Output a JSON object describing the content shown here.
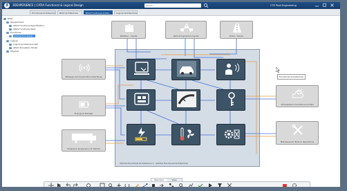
{
  "title_bar": {
    "app_title": "3DEXPERIENCE | CATIA Functional & Logical Design",
    "search_placeholder": "Search",
    "user_name": "CTE Prod Engineering"
  },
  "tabs": [
    {
      "label": "Functional Architecture"
    },
    {
      "label": "RFLP Architecture"
    },
    {
      "label": "RFLP Functional Archit..."
    },
    {
      "label": "Logical Architecture"
    }
  ],
  "tree": [
    {
      "label": "RFLP",
      "level": 0,
      "selected": false
    },
    {
      "label": "Requirement",
      "level": 1,
      "selected": false
    },
    {
      "label": "ADAS Functional Specification",
      "level": 2,
      "selected": false
    },
    {
      "label": "ADAS Functional Spec",
      "level": 2,
      "selected": false
    },
    {
      "label": "Functional",
      "level": 1,
      "selected": false
    },
    {
      "label": "Vehicle Functional...",
      "level": 2,
      "selected": true
    },
    {
      "label": "Logical",
      "level": 1,
      "selected": false
    },
    {
      "label": "Logical Architecture Ref",
      "level": 2,
      "selected": false
    },
    {
      "label": "ADAS Simulation Model",
      "level": 2,
      "selected": false
    },
    {
      "label": "Physical",
      "level": 1,
      "selected": false
    }
  ],
  "diagram": {
    "top_blocks": [
      {
        "label": "Weather - Inputs"
      },
      {
        "label": "Vehicle Dynamics Inputs"
      },
      {
        "label": "Road - Inputs"
      }
    ],
    "left_blocks": [
      {
        "label": "Wireless Communication Interfaces"
      },
      {
        "label": "Energy & Storage"
      },
      {
        "label": "Chassis & Suspension of Vehicle"
      }
    ],
    "right_blocks": [
      {
        "label": "Atmospheric Conditions & Data"
      },
      {
        "label": "Maintenance Tools & Operations"
      }
    ],
    "container_label": "Vehicle Functional Architecture 1 - Vehicle Functional Architecture",
    "tooltip": "Functional Architecture",
    "tiles": [
      {
        "icon": "tablet-icon"
      },
      {
        "icon": "car-front-icon"
      },
      {
        "icon": "driver-sensor-icon"
      },
      {
        "icon": "dashboard-icon"
      },
      {
        "icon": "seat-icon"
      },
      {
        "icon": "road-curve-icon"
      },
      {
        "icon": "key-icon"
      },
      {
        "icon": "battery-charge-icon"
      },
      {
        "icon": "seat-icon"
      },
      {
        "icon": "temperature-fan-icon"
      },
      {
        "icon": "gear-icon"
      }
    ]
  },
  "bottom_toolbar": {
    "tabs": [
      {
        "label": "Standard"
      },
      {
        "label": "View"
      }
    ],
    "icons": [
      "move-icon",
      "select-icon",
      "undo-icon",
      "redo-icon",
      "update-icon",
      "fit-icon",
      "zoom-icon",
      "pan-icon",
      "rotate-icon",
      "sketch-icon",
      "connect-icon",
      "port-icon",
      "flow-icon",
      "layout-icon",
      "search-icon",
      "analyze-icon",
      "check-icon",
      "simulate-icon",
      "filter-icon",
      "tools-icon",
      "plugin-icon",
      "settings-icon"
    ]
  },
  "colors": {
    "title_bar": "#1f4f87",
    "active_tab": "#1f5a99",
    "tile_bg": "#3d5366",
    "container_bg": "#d4dce6",
    "link_blue": "#3f6fd8",
    "link_orange": "#e89a3d"
  }
}
